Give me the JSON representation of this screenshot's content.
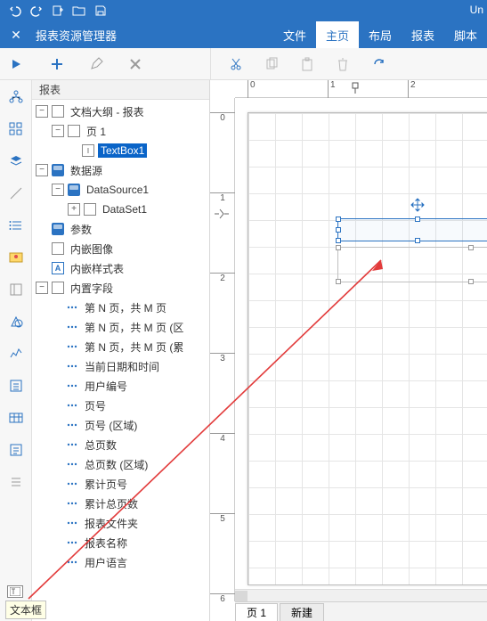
{
  "qat_title_fragment": "Un",
  "panel": {
    "title": "报表资源管理器",
    "close": "✕"
  },
  "menuTabs": [
    "文件",
    "主页",
    "布局",
    "报表",
    "脚本"
  ],
  "activeMenuTab": 1,
  "treeHeader": "报表",
  "tree": {
    "docOutline": "文档大纲 - 报表",
    "page1": "页 1",
    "textbox1": "TextBox1",
    "datasource_root": "数据源",
    "datasource1": "DataSource1",
    "dataset1": "DataSet1",
    "params": "参数",
    "embImg": "内嵌图像",
    "embStyle": "内嵌样式表",
    "builtin": "内置字段",
    "builtinItems": [
      "第 N 页，共 M 页",
      "第 N 页，共 M 页 (区",
      "第 N 页，共 M 页 (累",
      "当前日期和时间",
      "用户编号",
      "页号",
      "页号 (区域)",
      "总页数",
      "总页数 (区域)",
      "累计页号",
      "累计总页数",
      "报表文件夹",
      "报表名称",
      "用户语言"
    ]
  },
  "rulerH": [
    "0",
    "1",
    "2"
  ],
  "rulerV": [
    "0",
    "1",
    "2",
    "3",
    "4",
    "5",
    "6"
  ],
  "bottomTabs": {
    "active": "页 1",
    "inactive": "新建"
  },
  "tooltip": "文本框",
  "icons": {
    "undo": "undo-icon",
    "redo": "redo-icon",
    "new": "new-icon",
    "open": "open-icon",
    "save": "save-icon",
    "play": "play-icon",
    "plus": "plus-icon",
    "edit": "edit-icon",
    "delete": "delete-icon",
    "cut": "cut-icon",
    "copy": "copy-icon",
    "paste": "paste-icon",
    "trash": "trash-icon",
    "redo2": "redo-icon"
  }
}
